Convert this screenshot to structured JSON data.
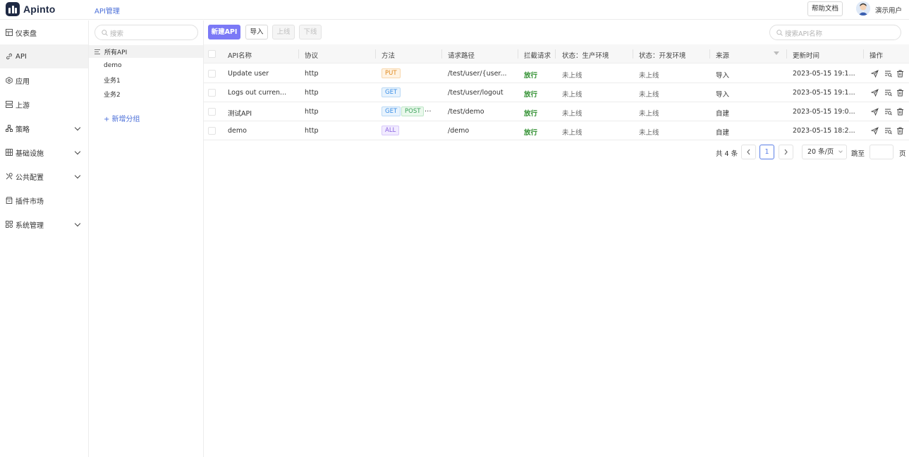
{
  "app": {
    "logo_text": "Apinto",
    "breadcrumb": "API管理",
    "help_label": "帮助文档",
    "user_name": "演示用户"
  },
  "sidebar": {
    "items": [
      {
        "label": "仪表盘",
        "icon": "dashboard-icon",
        "active": false,
        "expandable": false
      },
      {
        "label": "API",
        "icon": "link-icon",
        "active": true,
        "expandable": false
      },
      {
        "label": "应用",
        "icon": "app-icon",
        "active": false,
        "expandable": false
      },
      {
        "label": "上游",
        "icon": "server-icon",
        "active": false,
        "expandable": false
      },
      {
        "label": "策略",
        "icon": "strategy-icon",
        "active": false,
        "expandable": true
      },
      {
        "label": "基础设施",
        "icon": "infrastructure-icon",
        "active": false,
        "expandable": true
      },
      {
        "label": "公共配置",
        "icon": "config-icon",
        "active": false,
        "expandable": true
      },
      {
        "label": "插件市场",
        "icon": "plugin-icon",
        "active": false,
        "expandable": false
      },
      {
        "label": "系统管理",
        "icon": "system-icon",
        "active": false,
        "expandable": true
      }
    ]
  },
  "groups": {
    "search_placeholder": "搜索",
    "all_label": "所有API",
    "items": [
      "demo",
      "业务1",
      "业务2"
    ],
    "add_label": "+ 新增分组"
  },
  "toolbar": {
    "new_label": "新建API",
    "import_label": "导入",
    "online_label": "上线",
    "offline_label": "下线",
    "search_placeholder": "搜索API名称"
  },
  "table": {
    "columns": [
      "API名称",
      "协议",
      "方法",
      "请求路径",
      "拦截请求",
      "状态：生产环境",
      "状态：开发环境",
      "来源",
      "更新时间",
      "操作"
    ],
    "rows": [
      {
        "name": "Update user",
        "protocol": "http",
        "methods": [
          "PUT"
        ],
        "more": "",
        "path": "/test/user/{user...",
        "intercept": "放行",
        "prod_status": "未上线",
        "dev_status": "未上线",
        "source": "导入",
        "updated": "2023-05-15 19:1..."
      },
      {
        "name": "Logs out curren...",
        "protocol": "http",
        "methods": [
          "GET"
        ],
        "more": "",
        "path": "/test/user/logout",
        "intercept": "放行",
        "prod_status": "未上线",
        "dev_status": "未上线",
        "source": "导入",
        "updated": "2023-05-15 19:1..."
      },
      {
        "name": "测试API",
        "protocol": "http",
        "methods": [
          "GET",
          "POST"
        ],
        "more": "...",
        "path": "/test/demo",
        "intercept": "放行",
        "prod_status": "未上线",
        "dev_status": "未上线",
        "source": "自建",
        "updated": "2023-05-15 19:0..."
      },
      {
        "name": "demo",
        "protocol": "http",
        "methods": [
          "ALL"
        ],
        "more": "",
        "path": "/demo",
        "intercept": "放行",
        "prod_status": "未上线",
        "dev_status": "未上线",
        "source": "自建",
        "updated": "2023-05-15 18:2..."
      }
    ]
  },
  "pagination": {
    "total": "共 4 条",
    "current": "1",
    "page_size": "20 条/页",
    "jump_label": "跳至",
    "page_label": "页"
  },
  "colors": {
    "primary": "#7b79f6",
    "link": "#4b6fd8",
    "allow": "#2f8f2f"
  }
}
